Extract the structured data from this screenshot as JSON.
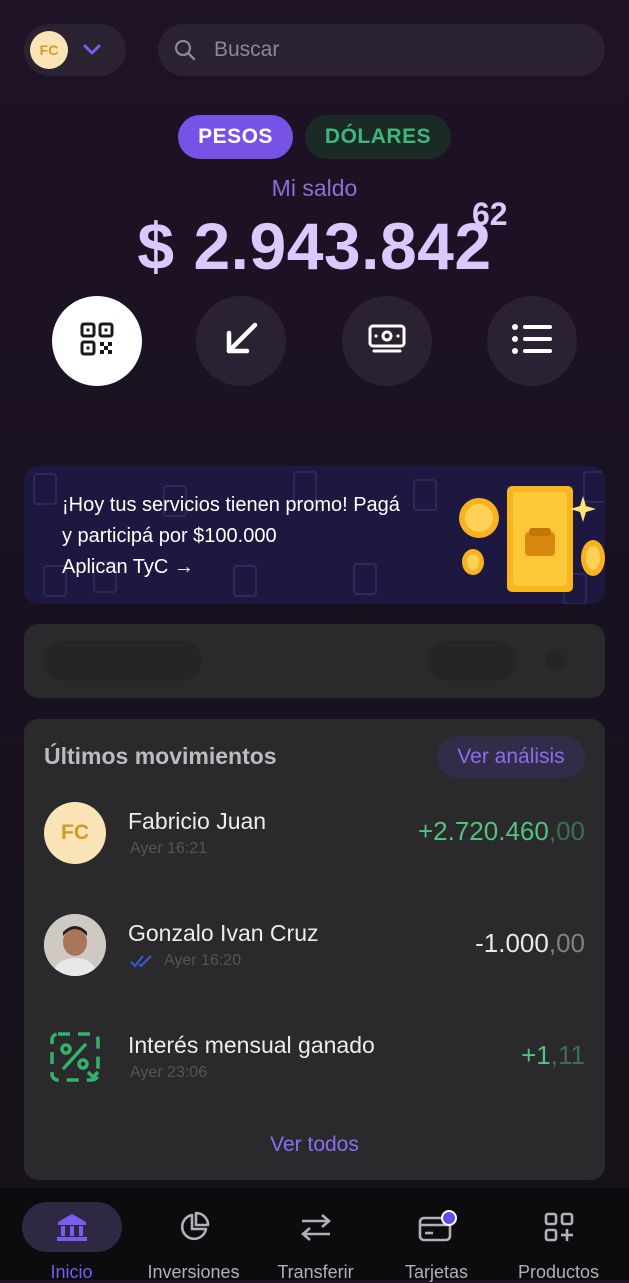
{
  "header": {
    "avatar_initials": "FC",
    "search_placeholder": "Buscar"
  },
  "currency_tabs": [
    {
      "label": "PESOS",
      "active": true
    },
    {
      "label": "DÓLARES",
      "active": false
    }
  ],
  "balance": {
    "label": "Mi saldo",
    "amount": "$ 2.943.842",
    "cents": "62"
  },
  "actions": [
    {
      "icon": "qr-code-icon"
    },
    {
      "icon": "arrow-down-left-icon"
    },
    {
      "icon": "cash-icon"
    },
    {
      "icon": "list-icon"
    }
  ],
  "promo": {
    "line1": "¡Hoy tus servicios tienen promo! Pagá",
    "line2": "y participá por $100.000",
    "line3": "Aplican TyC →"
  },
  "movements": {
    "title": "Últimos movimientos",
    "analysis_label": "Ver análisis",
    "items": [
      {
        "name": "Fabricio Juan",
        "time": "Ayer 16:21",
        "amount_int": "+2.720.460",
        "amount_cents": ",00",
        "type": "credit",
        "avatar": "FC"
      },
      {
        "name": "Gonzalo Ivan Cruz",
        "time": "Ayer 16:20",
        "amount_int": "-1.000",
        "amount_cents": ",00",
        "type": "debit",
        "avatar": "photo"
      },
      {
        "name": "Interés mensual ganado",
        "time": "Ayer 23:06",
        "amount_int": "+1",
        "amount_cents": ",11",
        "type": "credit",
        "avatar": "percent-icon"
      }
    ],
    "see_all_label": "Ver todos"
  },
  "nav": [
    {
      "label": "Inicio",
      "icon": "bank-icon",
      "active": true
    },
    {
      "label": "Inversiones",
      "icon": "pie-chart-icon",
      "active": false
    },
    {
      "label": "Transferir",
      "icon": "transfer-arrows-icon",
      "active": false
    },
    {
      "label": "Tarjetas",
      "icon": "card-icon",
      "active": false,
      "badge": true
    },
    {
      "label": "Productos",
      "icon": "grid-plus-icon",
      "active": false
    }
  ],
  "colors": {
    "accent": "#7653e6",
    "balance": "#d9c9ff",
    "positive": "#53c27f",
    "dollar_tab": "#3bb87a"
  }
}
